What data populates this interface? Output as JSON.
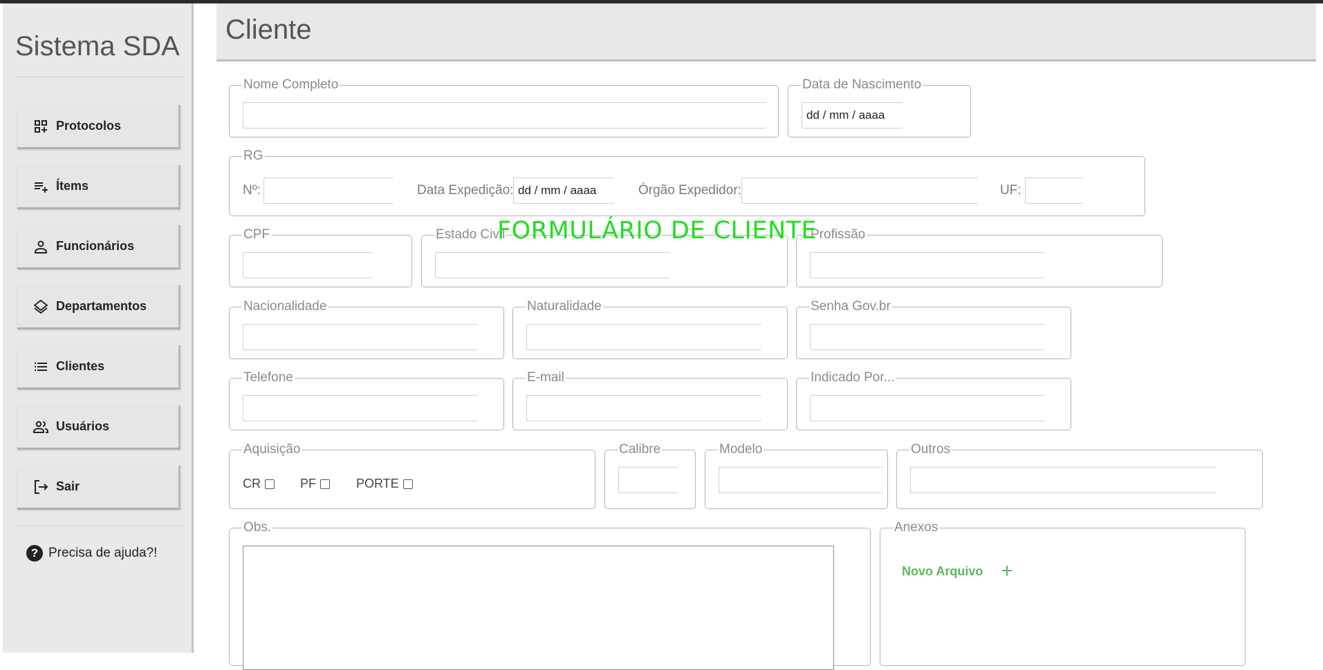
{
  "sidebar": {
    "brand": "Sistema SDA",
    "items": [
      {
        "label": "Protocolos",
        "icon": "grid-add-icon"
      },
      {
        "label": "Ítems",
        "icon": "playlist-add-icon"
      },
      {
        "label": "Funcionários",
        "icon": "person-icon"
      },
      {
        "label": "Departamentos",
        "icon": "layers-icon"
      },
      {
        "label": "Clientes",
        "icon": "list-icon"
      },
      {
        "label": "Usuários",
        "icon": "people-icon"
      },
      {
        "label": "Sair",
        "icon": "logout-icon"
      }
    ],
    "help": "Precisa de ajuda?!"
  },
  "header": {
    "title": "Cliente"
  },
  "overlay_title": "FORMULÁRIO DE CLIENTE",
  "form": {
    "nome_completo": {
      "legend": "Nome Completo",
      "value": ""
    },
    "data_nascimento": {
      "legend": "Data de Nascimento",
      "value": "dd / mm / aaaa"
    },
    "rg": {
      "legend": "RG",
      "numero_label": "Nº:",
      "data_expedicao_label": "Data Expedição:",
      "data_expedicao_value": "dd / mm / aaaa",
      "orgao_label": "Órgão Expedidor:",
      "uf_label": "UF:"
    },
    "cpf": {
      "legend": "CPF"
    },
    "estado_civil": {
      "legend": "Estado Civil"
    },
    "profissao": {
      "legend": "Profissão"
    },
    "nacionalidade": {
      "legend": "Nacionalidade"
    },
    "naturalidade": {
      "legend": "Naturalidade"
    },
    "senha_gov": {
      "legend": "Senha Gov.br"
    },
    "telefone": {
      "legend": "Telefone"
    },
    "email": {
      "legend": "E-mail"
    },
    "indicado_por": {
      "legend": "Indicado Por..."
    },
    "aquisicao": {
      "legend": "Aquisição",
      "options": [
        "CR",
        "PF",
        "PORTE"
      ]
    },
    "calibre": {
      "legend": "Calibre"
    },
    "modelo": {
      "legend": "Modelo"
    },
    "outros": {
      "legend": "Outros"
    },
    "obs": {
      "legend": "Obs."
    },
    "anexos": {
      "legend": "Anexos",
      "new_file": "Novo Arquivo"
    }
  }
}
